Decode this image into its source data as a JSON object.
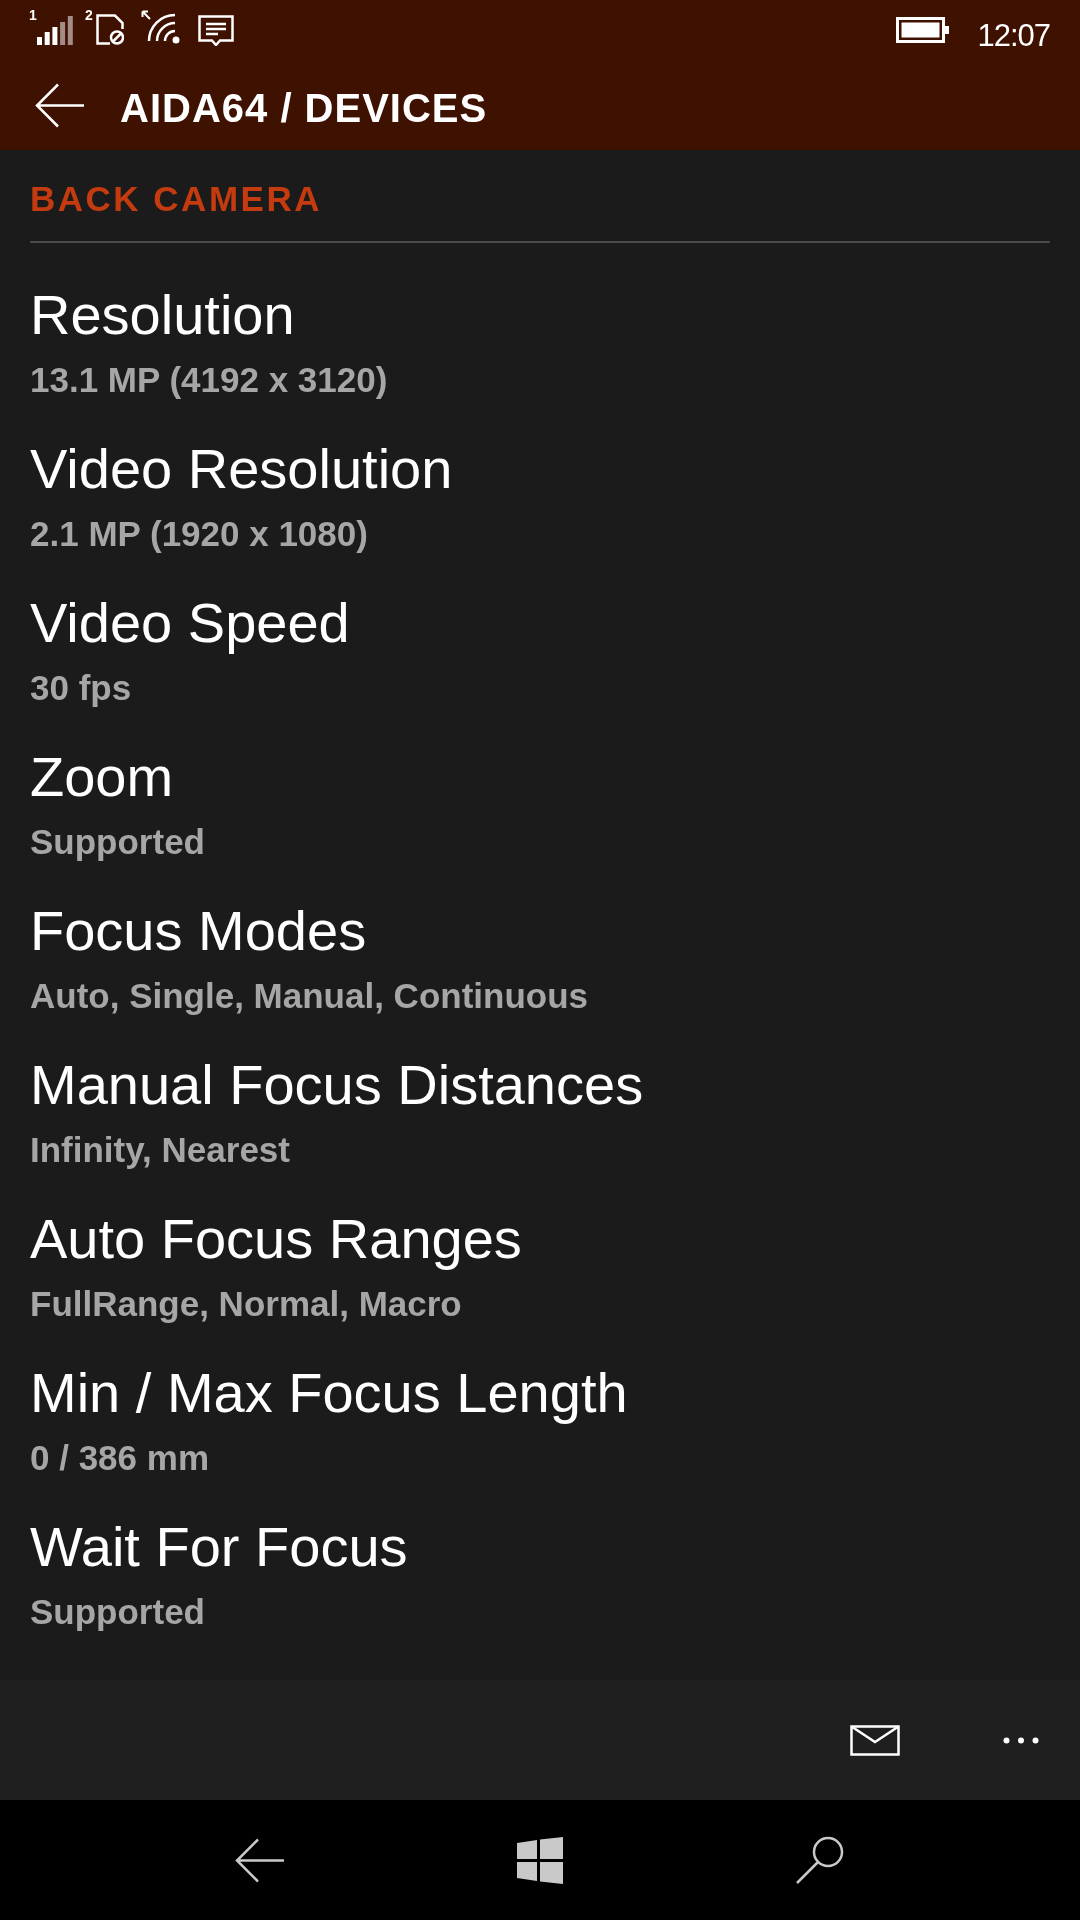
{
  "status_bar": {
    "sim1_label": "1",
    "sim2_label": "2",
    "time": "12:07"
  },
  "header": {
    "title": "AIDA64 / DEVICES"
  },
  "section": {
    "title": "BACK CAMERA"
  },
  "properties": [
    {
      "name": "Resolution",
      "value": "13.1 MP (4192 x 3120)"
    },
    {
      "name": "Video Resolution",
      "value": "2.1 MP (1920 x 1080)"
    },
    {
      "name": "Video Speed",
      "value": "30 fps"
    },
    {
      "name": "Zoom",
      "value": "Supported"
    },
    {
      "name": "Focus Modes",
      "value": "Auto, Single, Manual, Continuous"
    },
    {
      "name": "Manual Focus Distances",
      "value": "Infinity, Nearest"
    },
    {
      "name": "Auto Focus Ranges",
      "value": "FullRange, Normal, Macro"
    },
    {
      "name": "Min / Max Focus Length",
      "value": "0 / 386 mm"
    },
    {
      "name": "Wait For Focus",
      "value": "Supported"
    }
  ]
}
